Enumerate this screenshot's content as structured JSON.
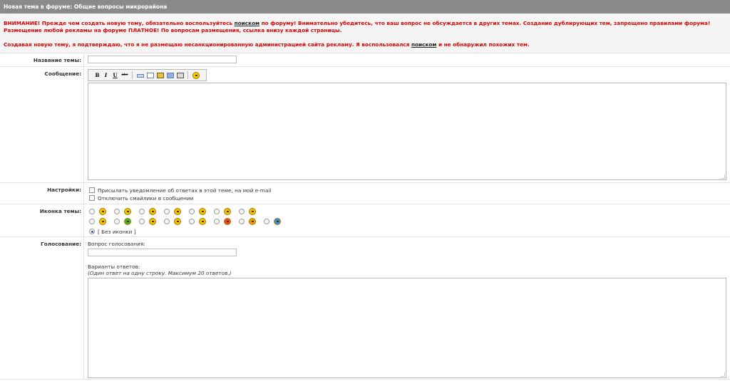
{
  "header": {
    "title": "Новая тема в форуме: Общие вопросы микрорайона"
  },
  "notice": {
    "part1": "ВНИМАНИЕ! Прежде чем создать новую тему, обязательно воспользуйтесь ",
    "link1": "поиском",
    "part2": " по форуму! Внимательно убедитесь, что ваш вопрос не обсуждается в других темах. Создание дублирующих тем, запрещено правилами форума! Размещение любой рекламы на форуме ПЛАТНОЕ! По вопросам размещения, ссылка внизу каждой страницы.",
    "line2_part1": "Создавая новую тему, я подтверждаю, что я не размещаю несанкционированную администрацией сайта рекламу. Я воспользовался ",
    "link2": "поиском",
    "line2_part2": " и не обнаружил похожих тем."
  },
  "title_row": {
    "label": "Название темы:",
    "value": ""
  },
  "message_row": {
    "label": "Сообщение:",
    "value": "",
    "toolbar": {
      "bold": "B",
      "italic": "I",
      "underline": "U",
      "strike": "abc"
    }
  },
  "settings_row": {
    "label": "Настройки:",
    "notify_label": "Присылать уведомление об ответах в этой теме, на мой e-mail",
    "disable_smilies_label": "Отключить смайлики в сообщении",
    "notify_checked": false,
    "disable_smilies_checked": false
  },
  "icon_row": {
    "label": "Иконка темы:",
    "no_icon_label": "[ Без иконки ]",
    "selected": "no-icon",
    "icons": [
      {
        "name": "smile",
        "color": "#f3c200"
      },
      {
        "name": "happy",
        "color": "#f3c200"
      },
      {
        "name": "wink",
        "color": "#f3c200"
      },
      {
        "name": "neutral",
        "color": "#f3c200"
      },
      {
        "name": "grin",
        "color": "#f3c200"
      },
      {
        "name": "surprised",
        "color": "#f3c200"
      },
      {
        "name": "laugh",
        "color": "#f3c200"
      },
      {
        "name": "sad",
        "color": "#f3c200"
      },
      {
        "name": "sick",
        "color": "#4caf28"
      },
      {
        "name": "cool",
        "color": "#f3c200"
      },
      {
        "name": "eyes",
        "color": "#f3c200"
      },
      {
        "name": "tongue",
        "color": "#f3c200"
      },
      {
        "name": "heart",
        "color": "#e84a2a"
      },
      {
        "name": "exclamation",
        "color": "#f2a000"
      },
      {
        "name": "question",
        "color": "#3b8de0"
      }
    ]
  },
  "poll_row": {
    "label": "Голосование:",
    "question_label": "Вопрос голосования:",
    "question_value": "",
    "options_label": "Варианты ответов:",
    "options_hint": "(Один ответ на одну строку. Максимум 20 ответов.)",
    "options_value": ""
  }
}
